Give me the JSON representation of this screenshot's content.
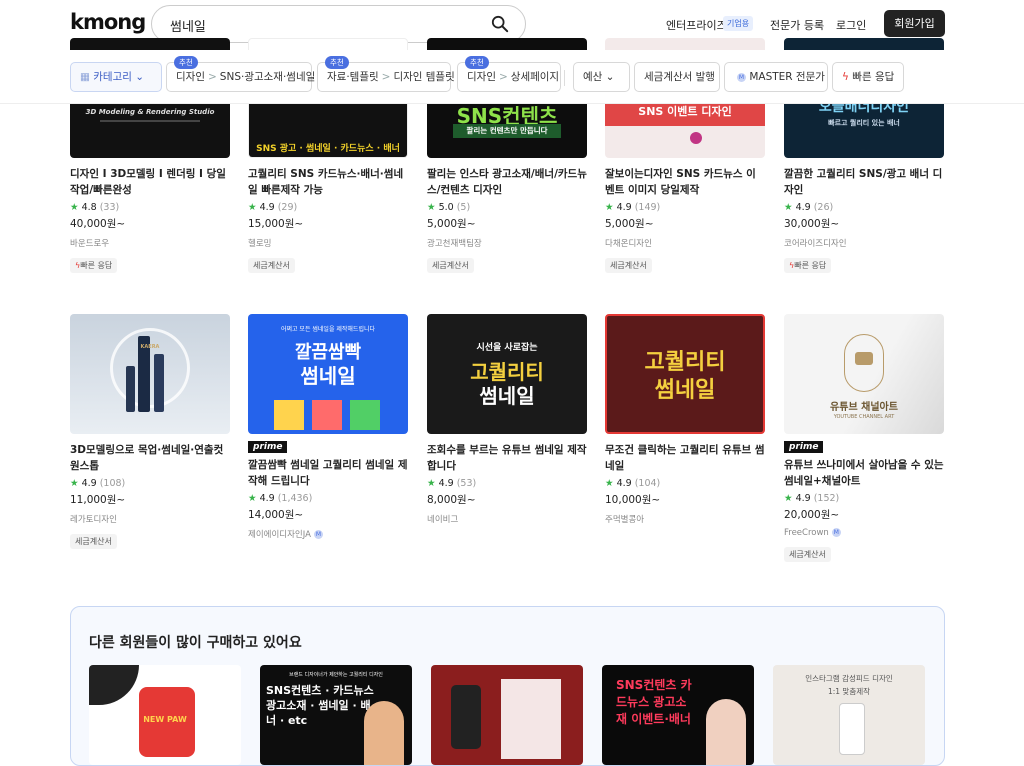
{
  "header": {
    "logo": "kmong",
    "search_value": "썸네일",
    "nav_enterprise": "엔터프라이즈",
    "nav_enterprise_badge": "기업용",
    "nav_expert": "전문가 등록",
    "nav_login": "로그인",
    "nav_join": "회원가입"
  },
  "filters": {
    "category": "카테고리",
    "rec_badge": "추천",
    "rec1": {
      "a": "디자인",
      "b": "SNS·광고소재·썸네일"
    },
    "rec2": {
      "a": "자료·템플릿",
      "b": "디자인 템플릿"
    },
    "rec3": {
      "a": "디자인",
      "b": "상세페이지"
    },
    "budget": "예산",
    "tax": "세금계산서 발행",
    "master": "MASTER 전문가",
    "fast": "빠른 응답"
  },
  "row1": [
    {
      "title": "디자인 I 3D모델링 I 렌더링 I 당일작업/빠른완성",
      "rating": "4.8",
      "count": "(33)",
      "price": "40,000원~",
      "seller": "바운드로우",
      "tag": "빠른 응답",
      "thumb_text": "3D Modeling & Rendering Studio"
    },
    {
      "title": "고퀄리티 SNS 카드뉴스·배너·썸네일 빠른제작 가능",
      "rating": "4.9",
      "count": "(29)",
      "price": "15,000원~",
      "seller": "헬로밍",
      "tag": "세금계산서",
      "thumb_text": "SNS 광고 · 썸네일 · 카드뉴스 · 배너"
    },
    {
      "title": "팔리는 인스타 광고소재/배너/카드뉴스/컨텐츠 디자인",
      "rating": "5.0",
      "count": "(5)",
      "price": "5,000원~",
      "seller": "광고천재백팀장",
      "tag": "세금계산서",
      "thumb_text": "SNS컨텐츠",
      "thumb_sub": "팔리는 컨텐츠만 만듭니다"
    },
    {
      "title": "잘보이는디자인 SNS 카드뉴스 이벤트 이미지 당일제작",
      "rating": "4.9",
      "count": "(149)",
      "price": "5,000원~",
      "seller": "다채온디자인",
      "tag": "세금계산서",
      "thumb_text": "SNS 이벤트 디자인"
    },
    {
      "title": "깔끔한 고퀄리티 SNS/광고 배너 디자인",
      "rating": "4.9",
      "count": "(26)",
      "price": "30,000원~",
      "seller": "코어라이즈디자인",
      "tag": "빠른 응답",
      "thumb_text": "오늘배너디자인",
      "thumb_sub": "빠르고 퀄리티 있는 배너"
    }
  ],
  "row2": [
    {
      "title": "3D모델링으로 목업·썸네일·연출컷 원스톱",
      "rating": "4.9",
      "count": "(108)",
      "price": "11,000원~",
      "seller": "레가토디자인",
      "tag": "세금계산서",
      "thumb_text": "KAERA"
    },
    {
      "title": "깔끔쌈빡 썸네일 고퀄리티 썸네일 제작해 드립니다",
      "prime": "prime",
      "rating": "4.9",
      "count": "(1,436)",
      "price": "14,000원~",
      "seller": "제이에이디자인JA",
      "thumb_text": "깔끔쌈빡",
      "thumb_sub": "썸네일",
      "thumb_top": "어쩌고 모든 썸네일을 제작해드립니다"
    },
    {
      "title": "조회수를 부르는 유튜브 썸네일 제작합니다",
      "rating": "4.9",
      "count": "(53)",
      "price": "8,000원~",
      "seller": "네이비그",
      "thumb_text": "고퀄리티",
      "thumb_sub": "썸네일",
      "thumb_top": "시선을 사로잡는"
    },
    {
      "title": "무조건 클릭하는 고퀄리티 유튜브 썸네일",
      "rating": "4.9",
      "count": "(104)",
      "price": "10,000원~",
      "seller": "주먹별콩아",
      "thumb_text": "고퀄리티",
      "thumb_sub": "썸네일"
    },
    {
      "title": "유튜브 쓰나미에서 살아남을 수 있는 썸네일+채널아트",
      "prime": "prime",
      "rating": "4.9",
      "count": "(152)",
      "price": "20,000원~",
      "seller": "FreeCrown",
      "tag": "세금계산서",
      "thumb_text": "유튜브 채널아트",
      "thumb_sub": "YOUTUBE CHANNEL ART"
    }
  ],
  "panel": {
    "title": "다른 회원들이 많이 구매하고 있어요",
    "items": [
      {
        "text": "NEW PAW"
      },
      {
        "text": "SNS컨텐츠 · 카드뉴스 광고소재 · 썸네일 · 배너 · etc",
        "top": "브랜드 디자이너가 제안하는 고퀄리티 디자인"
      },
      {
        "text": ""
      },
      {
        "text": "SNS컨텐츠 카드뉴스 광고소재 이벤트·배너"
      },
      {
        "text": "인스타그램 감성피드 디자인",
        "sub": "1:1 맞춤제작"
      }
    ]
  },
  "colors": {
    "accent": "#4a6fe0",
    "star": "#37b34a",
    "fast": "#e53935",
    "join_bg": "#222222"
  }
}
